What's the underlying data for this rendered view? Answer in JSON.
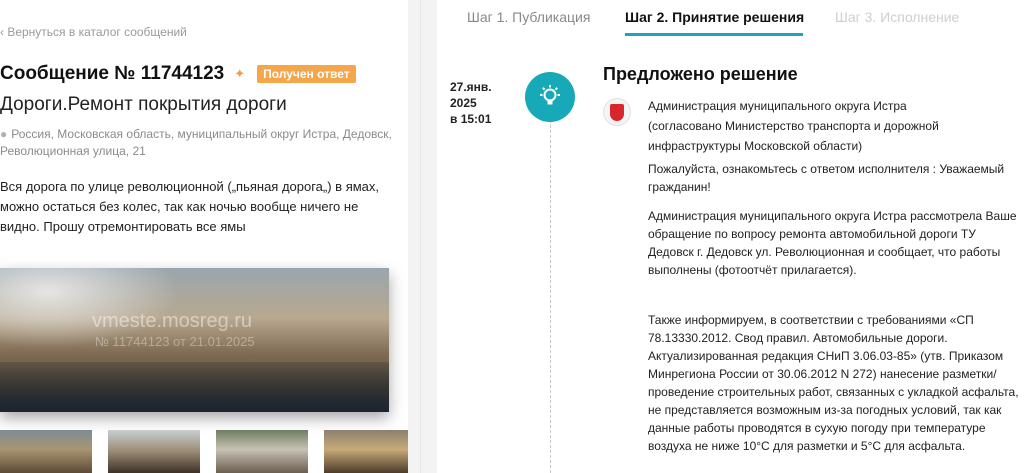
{
  "left": {
    "back_link": "‹ Вернуться в каталог сообщений",
    "title": "Сообщение № 11744123",
    "badge": "Получен ответ",
    "category": "Дороги.Ремонт покрытия дороги",
    "address": "Россия, Московская область, муниципальный округ Истра, Дедовск, Революционная улица, 21",
    "message": "Вся дорога по улице революционной („пьяная дорога„) в ямах, можно остаться без колес, так как ночью вообще ничего не видно. Прошу отремонтировать все ямы",
    "photo_watermark": "vmeste.mosreg.ru",
    "photo_watermark_sub": "№ 11744123 от 21.01.2025"
  },
  "tabs": [
    {
      "label": "Шаг 1. Публикация"
    },
    {
      "label": "Шаг 2. Принятие решения"
    },
    {
      "label": "Шаг 3. Исполнение"
    }
  ],
  "decision": {
    "date_line1": "27.янв.",
    "date_line2": "2025",
    "date_line3": "в 15:01",
    "title": "Предложено решение",
    "author": "Администрация муниципального округа Истра (согласовано Министерство транспорта и дорожной инфраструктуры Московской области)",
    "intro": "Пожалуйста, ознакомьтесь с ответом исполнителя : Уважаемый гражданин!",
    "para1": "Администрация муниципального округа Истра рассмотрела Ваше обращение по вопросу ремонта автомобильной дороги ТУ Дедовск г. Дедовск ул. Революционная и сообщает, что работы выполнены (фотоотчёт прилагается).",
    "para2": "Также информируем, в соответствии с требованиями «СП 78.13330.2012. Свод правил. Автомобильные дороги. Актуализированная редакция СНиП 3.06.03-85» (утв. Приказом Минрегиона России от 30.06.2012 N 272) нанесение разметки/ проведение строительных работ, связанных с укладкой асфальта, не представляется возможным из-за погодных условий, так как данные работы проводятся в сухую погоду при температуре воздуха не ниже 10°C для разметки и 5°C для асфальта."
  },
  "colors": {
    "accent": "#17a9b8",
    "badge": "#f5a54a"
  },
  "icons": {
    "timeline": "lightbulb-icon",
    "address": "map-pin-icon"
  }
}
